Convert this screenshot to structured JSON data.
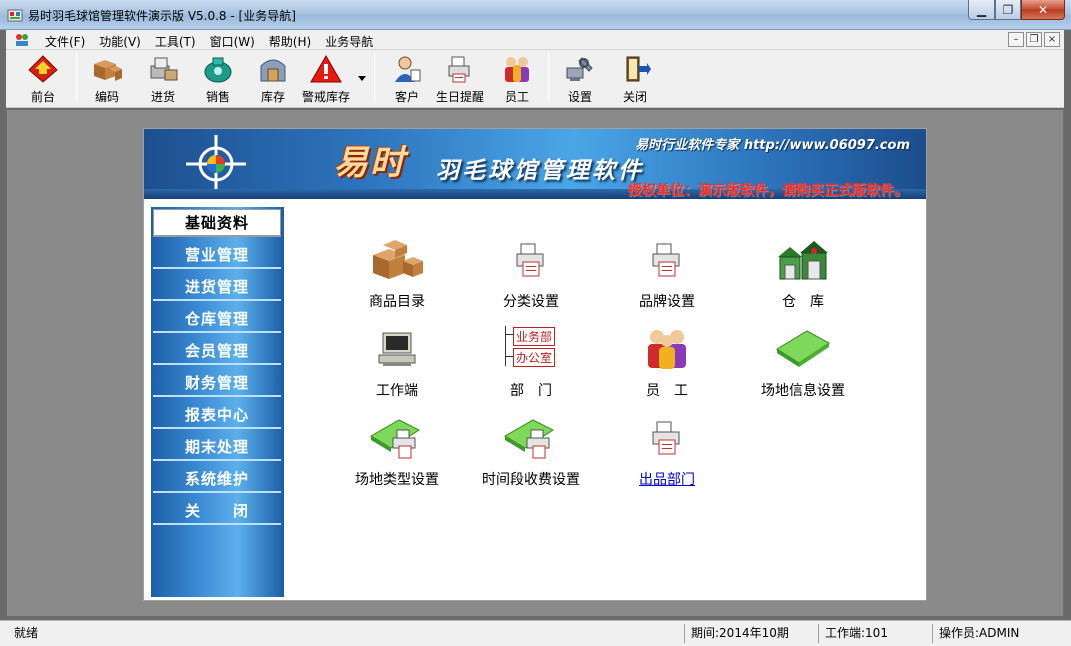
{
  "window": {
    "title": "易时羽毛球馆管理软件演示版 V5.0.8 - [业务导航]",
    "min_glyph": "▁",
    "max_glyph": "❐",
    "close_glyph": "✕"
  },
  "menu": {
    "items": [
      {
        "label": "文件(F)"
      },
      {
        "label": "功能(V)"
      },
      {
        "label": "工具(T)"
      },
      {
        "label": "窗口(W)"
      },
      {
        "label": "帮助(H)"
      },
      {
        "label": "业务导航"
      }
    ],
    "mdi_min": "–",
    "mdi_restore": "❐",
    "mdi_close": "×"
  },
  "toolbar": {
    "items": [
      {
        "label": "前台",
        "icon": "front-desk-icon"
      },
      {
        "label": "编码",
        "icon": "boxes-icon"
      },
      {
        "label": "进货",
        "icon": "purchase-icon"
      },
      {
        "label": "销售",
        "icon": "sales-icon"
      },
      {
        "label": "库存",
        "icon": "inventory-icon"
      },
      {
        "label": "警戒库存",
        "icon": "warning-icon"
      },
      {
        "label": "客户",
        "icon": "customer-icon"
      },
      {
        "label": "生日提醒",
        "icon": "birthday-reminder-icon"
      },
      {
        "label": "员工",
        "icon": "staff-icon"
      },
      {
        "label": "设置",
        "icon": "settings-icon"
      },
      {
        "label": "关闭",
        "icon": "exit-door-icon"
      }
    ]
  },
  "banner": {
    "brand": "易时",
    "product": "羽毛球馆管理软件",
    "vendor": "易时行业软件专家 http://www.06097.com",
    "license": "授权单位：演示版软件，请购买正式版软件。"
  },
  "sidenav": {
    "items": [
      {
        "label": "基础资料",
        "active": true
      },
      {
        "label": "营业管理"
      },
      {
        "label": "进货管理"
      },
      {
        "label": "仓库管理"
      },
      {
        "label": "会员管理"
      },
      {
        "label": "财务管理"
      },
      {
        "label": "报表中心"
      },
      {
        "label": "期末处理"
      },
      {
        "label": "系统维护"
      },
      {
        "label": "关　　闭"
      }
    ]
  },
  "grid": {
    "items": [
      {
        "label": "商品目录",
        "icon": "boxes-icon"
      },
      {
        "label": "分类设置",
        "icon": "printer-doc-icon"
      },
      {
        "label": "品牌设置",
        "icon": "printer-doc-icon"
      },
      {
        "label": "仓　库",
        "icon": "warehouse-icon"
      },
      {
        "label": "工作端",
        "icon": "computer-icon"
      },
      {
        "label": "部　门",
        "icon": "org-chart-icon",
        "org_top": "业务部",
        "org_bottom": "办公室"
      },
      {
        "label": "员　工",
        "icon": "staff-icon"
      },
      {
        "label": "场地信息设置",
        "icon": "green-folder-icon"
      },
      {
        "label": "场地类型设置",
        "icon": "green-folder-doc-icon"
      },
      {
        "label": "时间段收费设置",
        "icon": "green-folder-doc-icon"
      },
      {
        "label": "出品部门",
        "icon": "printer-doc-icon",
        "link": true
      }
    ]
  },
  "status": {
    "ready": "就绪",
    "period": "期间:2014年10期",
    "workstation": "工作端:101",
    "operator": "操作员:ADMIN"
  }
}
